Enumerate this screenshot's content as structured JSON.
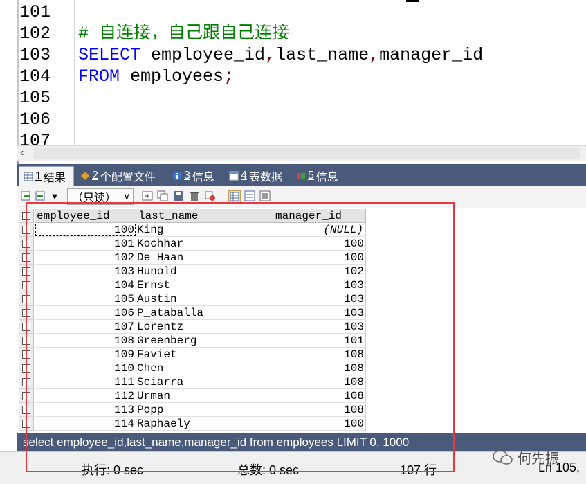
{
  "editor": {
    "line_numbers": [
      "101",
      "102",
      "103",
      "104",
      "105",
      "106",
      "107"
    ],
    "comment": "# 自连接，自己跟自己连接",
    "line103": {
      "kw": "SELECT",
      "p1": " employee_id",
      "c1": ",",
      "p2": "last_name",
      "c2": ",",
      "p3": "manager_id"
    },
    "line104": {
      "kw": "FROM",
      "p1": " employees",
      "end": ";"
    }
  },
  "tabs": [
    {
      "num": "1",
      "label": "结果",
      "icon": "grid-icon"
    },
    {
      "num": "2",
      "label": "个配置文件",
      "icon": "profile-icon"
    },
    {
      "num": "3",
      "label": "信息",
      "icon": "info-icon"
    },
    {
      "num": "4",
      "label": "表数据",
      "icon": "table-icon"
    },
    {
      "num": "5",
      "label": "信息",
      "icon": "history-icon"
    }
  ],
  "toolbar": {
    "readonly_label": "（只读）"
  },
  "grid": {
    "columns": [
      "employee_id",
      "last_name",
      "manager_id"
    ],
    "rows": [
      [
        "100",
        "King",
        "(NULL)"
      ],
      [
        "101",
        "Kochhar",
        "100"
      ],
      [
        "102",
        "De Haan",
        "100"
      ],
      [
        "103",
        "Hunold",
        "102"
      ],
      [
        "104",
        "Ernst",
        "103"
      ],
      [
        "105",
        "Austin",
        "103"
      ],
      [
        "106",
        "P_ataballa",
        "103"
      ],
      [
        "107",
        "Lorentz",
        "103"
      ],
      [
        "108",
        "Greenberg",
        "101"
      ],
      [
        "109",
        "Faviet",
        "108"
      ],
      [
        "110",
        "Chen",
        "108"
      ],
      [
        "111",
        "Sciarra",
        "108"
      ],
      [
        "112",
        "Urman",
        "108"
      ],
      [
        "113",
        "Popp",
        "108"
      ],
      [
        "114",
        "Raphaely",
        "100"
      ]
    ]
  },
  "query_text": "select employee_id,last_name,manager_id from employees LIMIT 0, 1000",
  "status": {
    "exec": "执行: 0 sec",
    "total": "总数: 0 sec",
    "rows": "107 行",
    "position": "Ln 105,"
  },
  "watermark": "何先振",
  "colors": {
    "keyword": "#0000ff",
    "comment": "#008000",
    "tab_bg": "#4a5a7a",
    "annotation": "#e8383d"
  }
}
